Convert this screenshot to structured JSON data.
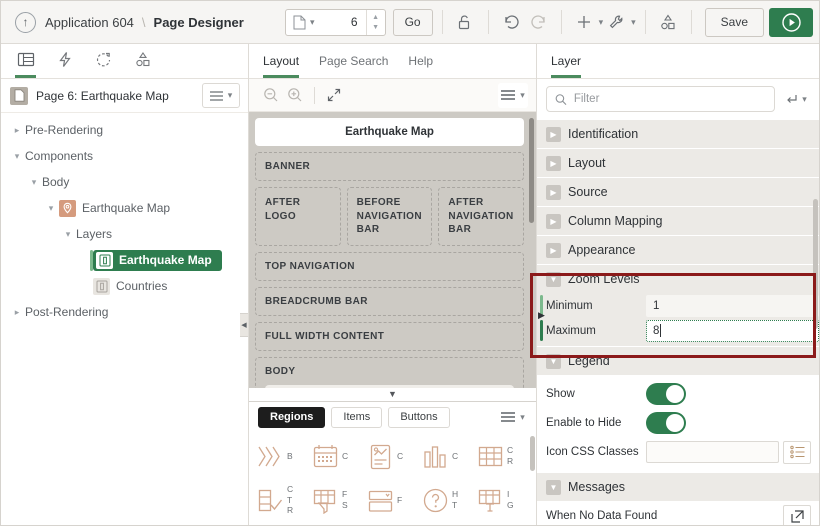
{
  "header": {
    "back_icon": "up-arrow-icon",
    "app_name": "Application 604",
    "separator": "\\",
    "page_designer": "Page Designer",
    "page_select": {
      "icon": "page-icon",
      "chevron": "chevron-down-icon",
      "value": "6"
    },
    "go_label": "Go",
    "tools": [
      {
        "name": "unlock-icon"
      },
      {
        "name": "undo-icon"
      },
      {
        "name": "redo-icon"
      },
      {
        "name": "add-icon"
      },
      {
        "name": "utilities-wrench-icon"
      },
      {
        "name": "shapes-icon"
      }
    ],
    "save_label": "Save",
    "run_icon": "play-circle-icon"
  },
  "left": {
    "tabs": [
      {
        "name": "rendering-tab",
        "icon": "page-layout-icon",
        "active": true
      },
      {
        "name": "dynamic-actions-tab",
        "icon": "lightning-icon",
        "active": false
      },
      {
        "name": "processing-tab",
        "icon": "refresh-cycle-icon",
        "active": false
      },
      {
        "name": "shared-components-tab",
        "icon": "shapes-icon",
        "active": false
      }
    ],
    "page_title": "Page 6: Earthquake Map",
    "page_icon": "page-doc-icon",
    "menu_icon": "hamburger-icon",
    "menu_chevron": "chevron-down-icon",
    "tree": [
      {
        "label": "Pre-Rendering",
        "indent": 0,
        "twisty": "chevron-right-icon",
        "icon": null,
        "selected": false
      },
      {
        "label": "Components",
        "indent": 0,
        "twisty": "chevron-down-icon",
        "icon": null,
        "selected": false
      },
      {
        "label": "Body",
        "indent": 1,
        "twisty": "chevron-down-icon",
        "icon": null,
        "selected": false
      },
      {
        "label": "Earthquake Map",
        "indent": 2,
        "twisty": "chevron-down-icon",
        "icon": "map-pin-icon",
        "selected": false
      },
      {
        "label": "Layers",
        "indent": 3,
        "twisty": "chevron-down-icon",
        "icon": null,
        "selected": false
      },
      {
        "label": "Earthquake Map",
        "indent": 4,
        "twisty": null,
        "icon": "layer-icon",
        "selected": true
      },
      {
        "label": "Countries",
        "indent": 4,
        "twisty": null,
        "icon": "layer-icon",
        "selected": false
      },
      {
        "label": "Post-Rendering",
        "indent": 0,
        "twisty": "chevron-right-icon",
        "icon": null,
        "selected": false
      }
    ],
    "collapse_handle": "collapse-left-icon"
  },
  "center": {
    "tabs": [
      {
        "label": "Layout",
        "active": true
      },
      {
        "label": "Page Search",
        "active": false
      },
      {
        "label": "Help",
        "active": false
      }
    ],
    "toolbar": [
      {
        "name": "zoom-out-icon"
      },
      {
        "name": "zoom-in-icon"
      },
      {
        "name": "expand-icon"
      },
      {
        "name": "layout-menu-icon"
      }
    ],
    "page_pill": "Earthquake Map",
    "regions": [
      {
        "label": "BANNER",
        "type": "full"
      },
      {
        "label": "AFTER LOGO",
        "type": "col"
      },
      {
        "label": "BEFORE NAVIGATION BAR",
        "type": "col"
      },
      {
        "label": "AFTER NAVIGATION BAR",
        "type": "col"
      },
      {
        "label": "TOP NAVIGATION",
        "type": "full"
      },
      {
        "label": "BREADCRUMB BAR",
        "type": "full"
      },
      {
        "label": "FULL WIDTH CONTENT",
        "type": "full"
      },
      {
        "label": "BODY",
        "type": "body"
      }
    ],
    "gallery": {
      "tabs": [
        {
          "label": "Regions",
          "active": true
        },
        {
          "label": "Items",
          "active": false
        },
        {
          "label": "Buttons",
          "active": false
        }
      ],
      "menu_icon": "hamburger-icon",
      "items": [
        {
          "icon": "chevrons-icon",
          "label": "B"
        },
        {
          "icon": "calendar-icon",
          "label": "C"
        },
        {
          "icon": "card-icon",
          "label": "C"
        },
        {
          "icon": "bar-chart-icon",
          "label": "C"
        },
        {
          "icon": "grid-table-icon",
          "label": "C R"
        },
        {
          "icon": "checklist-icon",
          "label": "C T R"
        },
        {
          "icon": "faceted-search-icon",
          "label": "F S"
        },
        {
          "icon": "form-icon",
          "label": "F"
        },
        {
          "icon": "help-circle-icon",
          "label": "H T"
        },
        {
          "icon": "interactive-grid-icon",
          "label": "I G"
        }
      ]
    }
  },
  "right": {
    "tabs": [
      {
        "label": "Layer",
        "active": true
      }
    ],
    "filter": {
      "icon": "search-icon",
      "placeholder": "Filter",
      "value": ""
    },
    "filter_button": {
      "icon": "arrow-return-icon",
      "chevron": "chevron-down-icon"
    },
    "groups": [
      {
        "label": "Identification",
        "expanded": false,
        "toggle": "chevron-right-icon"
      },
      {
        "label": "Layout",
        "expanded": false,
        "toggle": "chevron-right-icon"
      },
      {
        "label": "Source",
        "expanded": false,
        "toggle": "chevron-right-icon"
      },
      {
        "label": "Column Mapping",
        "expanded": false,
        "toggle": "chevron-right-icon"
      },
      {
        "label": "Appearance",
        "expanded": false,
        "toggle": "chevron-right-icon"
      }
    ],
    "zoom_levels": {
      "label": "Zoom Levels",
      "toggle": "chevron-down-icon",
      "minimum": {
        "label": "Minimum",
        "value": "1"
      },
      "maximum": {
        "label": "Maximum",
        "value": "8",
        "focused": true
      }
    },
    "legend": {
      "label": "Legend",
      "toggle": "chevron-down-icon",
      "show": {
        "label": "Show",
        "on": true
      },
      "enable_to_hide": {
        "label": "Enable to Hide",
        "on": true
      },
      "icon_css_classes": {
        "label": "Icon CSS Classes",
        "value": "",
        "picker": "list-picker-icon"
      }
    },
    "messages": {
      "label": "Messages",
      "toggle": "chevron-down-icon",
      "no_data_found": {
        "label": "When No Data Found",
        "button": "expand-editor-icon"
      }
    }
  },
  "colors": {
    "accent_green": "#2e7d4f",
    "highlight_red": "#8b1a1a",
    "tab_underline": "#4b8b5e"
  }
}
